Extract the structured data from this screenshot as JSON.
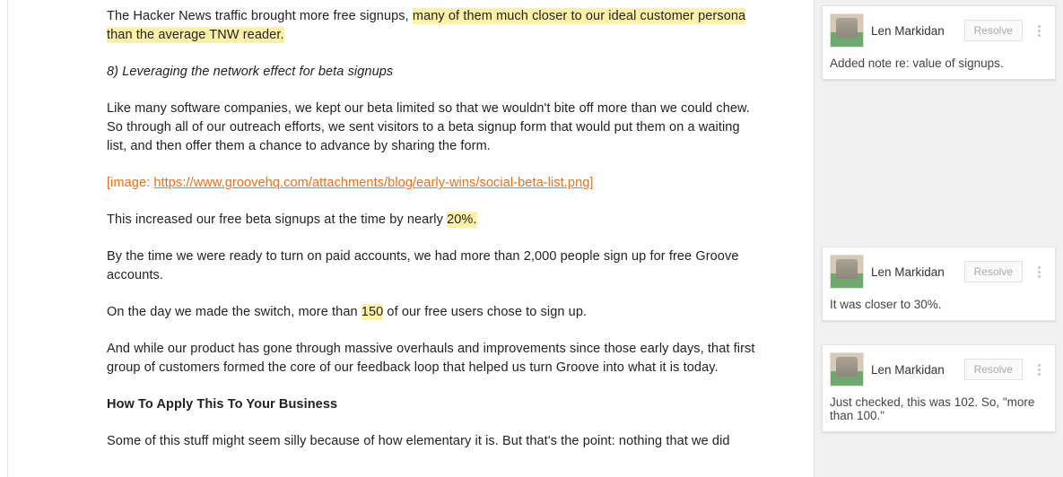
{
  "doc": {
    "p1_a": "The Hacker News traffic brought more free signups, ",
    "p1_hl": "many of them much closer to our ideal customer persona than the average TNW reader.",
    "p2": "8) Leveraging the network effect for beta signups",
    "p3": "Like many software companies, we kept our beta limited so that we wouldn't bite off more than we could chew. So through all of our outreach efforts, we sent visitors to a beta signup form that would put them on a waiting list, and then offer them a chance to advance by sharing the form.",
    "p4_prefix": "[image: ",
    "p4_link": "https://www.groovehq.com/attachments/blog/early-wins/social-beta-list.png",
    "p4_suffix": "]",
    "p5_a": "This increased our free beta signups at the time by nearly ",
    "p5_hl": "20%.",
    "p6": "By the time we were ready to turn on paid accounts, we had more than 2,000 people sign up for free Groove accounts.",
    "p7_a": "On the day we made the switch, more than ",
    "p7_hl": "150",
    "p7_b": " of our free users chose to sign up.",
    "p8": "And while our product has gone through massive overhauls and improvements since those early days, that first group of customers formed the core of our feedback loop that helped us turn Groove into what it is today.",
    "p9": "How To Apply This To Your Business",
    "p10": "Some of this stuff might seem silly because of how elementary it is. But that's the point: nothing that we did"
  },
  "sidebar": {
    "resolve_label": "Resolve",
    "comments": [
      {
        "author": "Len Markidan",
        "body": "Added note re: value of signups."
      },
      {
        "author": "Len Markidan",
        "body": "It was closer to 30%."
      },
      {
        "author": "Len Markidan",
        "body": "Just checked, this was 102. So, \"more than 100.\""
      }
    ]
  }
}
